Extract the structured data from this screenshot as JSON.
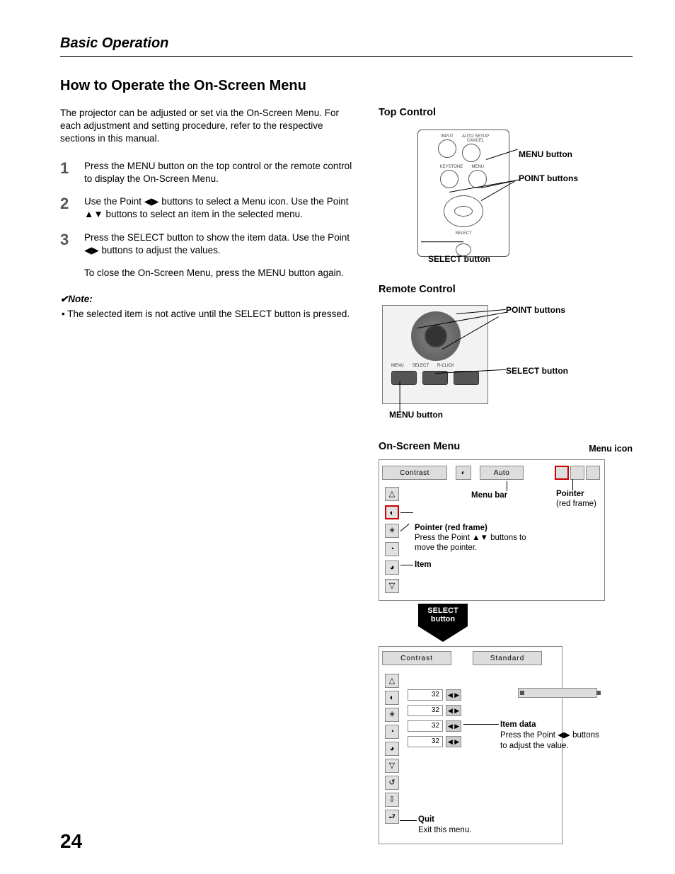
{
  "chapter": "Basic Operation",
  "section": "How to Operate the On-Screen Menu",
  "intro": "The projector can be adjusted or set via the On-Screen Menu. For each adjustment and setting procedure, refer to the respective sections in this manual.",
  "steps": [
    "Press the MENU button on the top control or the remote control to display the On-Screen Menu.",
    "Use the Point ◀▶ buttons to select a Menu icon. Use the Point ▲▼ buttons to select an item in the selected menu.",
    "Press the SELECT button to show the item data. Use the Point ◀▶ buttons to adjust the values."
  ],
  "closing": "To close the On-Screen Menu, press the MENU button again.",
  "note_heading": "✔Note:",
  "note_body": "The selected item is not active until the SELECT button is pressed.",
  "page_number": "24",
  "top_control": {
    "heading": "Top Control",
    "labels": {
      "menu": "MENU button",
      "point": "POINT buttons",
      "select": "SELECT button"
    },
    "btn_labels": {
      "input": "INPUT",
      "auto": "AUTO SETUP\nCANCEL",
      "keystone": "KEYSTONE",
      "menu": "MENU",
      "select": "SELECT"
    }
  },
  "remote_control": {
    "heading": "Remote Control",
    "labels": {
      "point": "POINT buttons",
      "select": "SELECT button",
      "menu": "MENU button"
    },
    "btn_labels": [
      "MENU",
      "SELECT",
      "R-CLICK"
    ]
  },
  "osm": {
    "heading": "On-Screen Menu",
    "menu_icon": "Menu icon",
    "menu_bar": "Menu bar",
    "pointer": "Pointer",
    "pointer_sub": "(red frame)",
    "pointer2": "Pointer (red frame)",
    "pointer2_sub": "Press the Point ▲▼ buttons to move the pointer.",
    "item": "Item",
    "select_btn": "SELECT button",
    "bar_name": "Contrast",
    "bar_sel": "Auto",
    "bar2_name": "Contrast",
    "bar2_sel": "Standard",
    "values": [
      "32",
      "32",
      "32",
      "32"
    ],
    "item_data": "Item data",
    "item_data_sub": "Press the Point ◀▶ buttons to adjust the value.",
    "quit": "Quit",
    "quit_sub": "Exit this menu."
  }
}
